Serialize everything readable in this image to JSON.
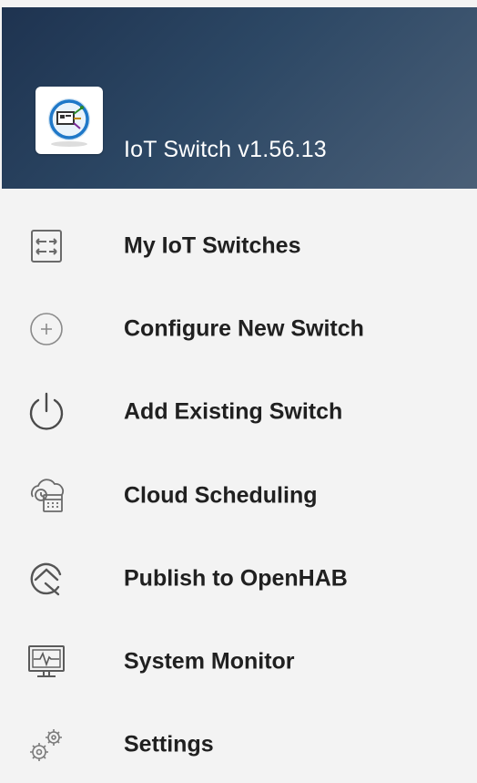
{
  "header": {
    "app_title": "IoT Switch v1.56.13",
    "logo_icon": "iot-switch-logo"
  },
  "menu": {
    "items": [
      {
        "label": "My IoT Switches",
        "icon": "switch-arrows-icon"
      },
      {
        "label": "Configure New Switch",
        "icon": "add-circle-icon"
      },
      {
        "label": "Add Existing Switch",
        "icon": "power-icon"
      },
      {
        "label": "Cloud Scheduling",
        "icon": "cloud-schedule-icon"
      },
      {
        "label": "Publish to OpenHAB",
        "icon": "openhab-icon"
      },
      {
        "label": "System Monitor",
        "icon": "monitor-icon"
      },
      {
        "label": "Settings",
        "icon": "gears-icon"
      }
    ]
  },
  "colors": {
    "header_start": "#1e3350",
    "header_end": "#4a5f77",
    "background": "#f3f3f3",
    "text": "#202020",
    "icon": "#6a6a6a"
  }
}
